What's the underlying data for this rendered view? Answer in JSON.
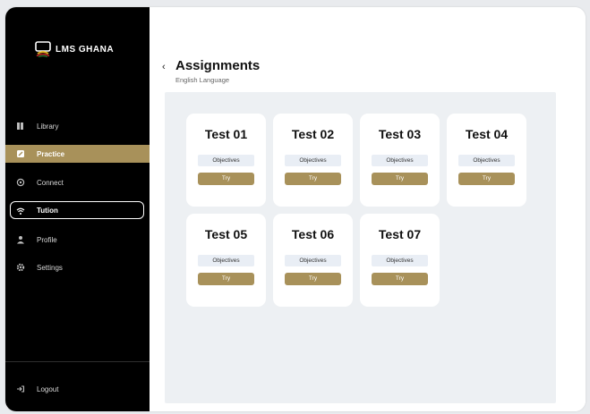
{
  "brand": {
    "name": "LMS GHANA",
    "accent": "#a8915a"
  },
  "sidebar": {
    "items": [
      {
        "label": "Library",
        "icon": "library-icon",
        "state": "normal"
      },
      {
        "label": "Practice",
        "icon": "practice-icon",
        "state": "active"
      },
      {
        "label": "Connect",
        "icon": "connect-icon",
        "state": "normal"
      },
      {
        "label": "Tution",
        "icon": "tution-icon",
        "state": "outlined"
      },
      {
        "label": "Profile",
        "icon": "profile-icon",
        "state": "normal"
      },
      {
        "label": "Settings",
        "icon": "settings-icon",
        "state": "normal"
      }
    ],
    "logout": {
      "label": "Logout",
      "icon": "logout-icon"
    }
  },
  "header": {
    "back": "‹",
    "title": "Assignments",
    "subtitle": "English Language"
  },
  "tests": [
    {
      "title": "Test 01",
      "objectives": "Objectives",
      "action": "Try"
    },
    {
      "title": "Test 02",
      "objectives": "Objectives",
      "action": "Try"
    },
    {
      "title": "Test 03",
      "objectives": "Objectives",
      "action": "Try"
    },
    {
      "title": "Test 04",
      "objectives": "Objectives",
      "action": "Try"
    },
    {
      "title": "Test 05",
      "objectives": "Objectives",
      "action": "Try"
    },
    {
      "title": "Test 06",
      "objectives": "Objectives",
      "action": "Try"
    },
    {
      "title": "Test 07",
      "objectives": "Objectives",
      "action": "Try"
    }
  ]
}
